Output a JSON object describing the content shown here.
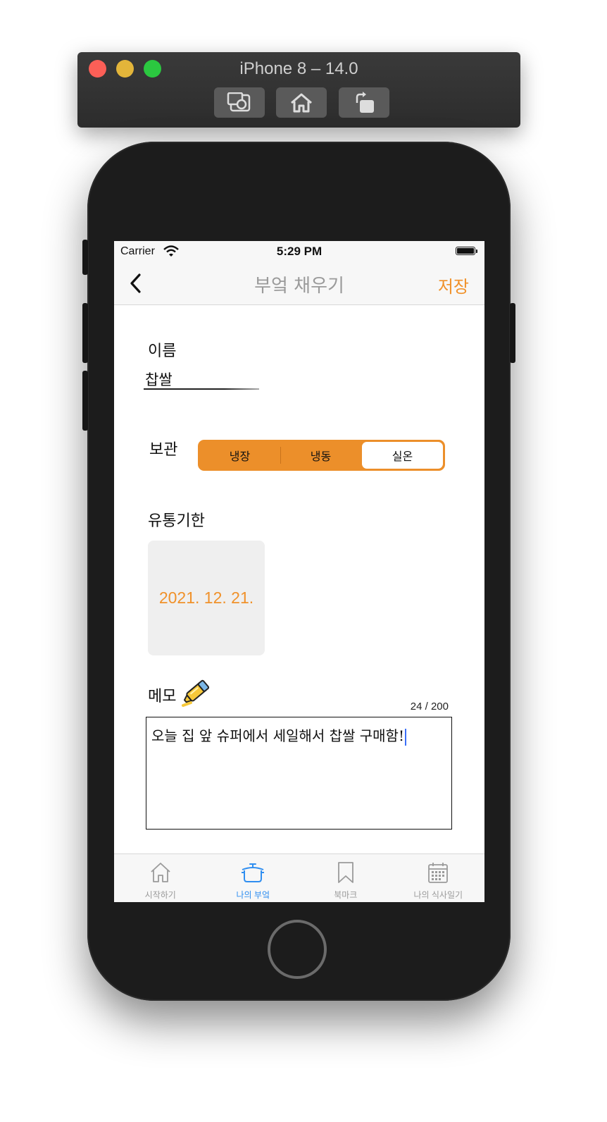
{
  "simulator": {
    "title": "iPhone 8 – 14.0",
    "buttons": [
      "screenshot-icon",
      "home-icon",
      "rotate-icon"
    ]
  },
  "status_bar": {
    "carrier": "Carrier",
    "time": "5:29 PM"
  },
  "nav": {
    "title": "부엌 채우기",
    "save_label": "저장",
    "back_icon": "chevron-left-icon"
  },
  "form": {
    "name_label": "이름",
    "name_value": "찹쌀",
    "storage_label": "보관",
    "storage_options": [
      "냉장",
      "냉동",
      "실온"
    ],
    "storage_selected": "실온",
    "expiry_label": "유통기한",
    "expiry_date": "2021. 12. 21.",
    "memo_label": "메모",
    "memo_icon": "highlighter-icon",
    "memo_counter": "24 / 200",
    "memo_text": "오늘 집 앞 슈퍼에서 세일해서 찹쌀 구매함!"
  },
  "tabs": [
    {
      "label": "시작하기",
      "icon": "house-icon",
      "active": false
    },
    {
      "label": "나의 부엌",
      "icon": "pot-icon",
      "active": true
    },
    {
      "label": "북마크",
      "icon": "bookmark-icon",
      "active": false
    },
    {
      "label": "나의 식사일기",
      "icon": "calendar-icon",
      "active": false
    }
  ],
  "colors": {
    "accent": "#f0912a",
    "active_tab": "#2f8ef0",
    "date_box": "#efefef"
  }
}
